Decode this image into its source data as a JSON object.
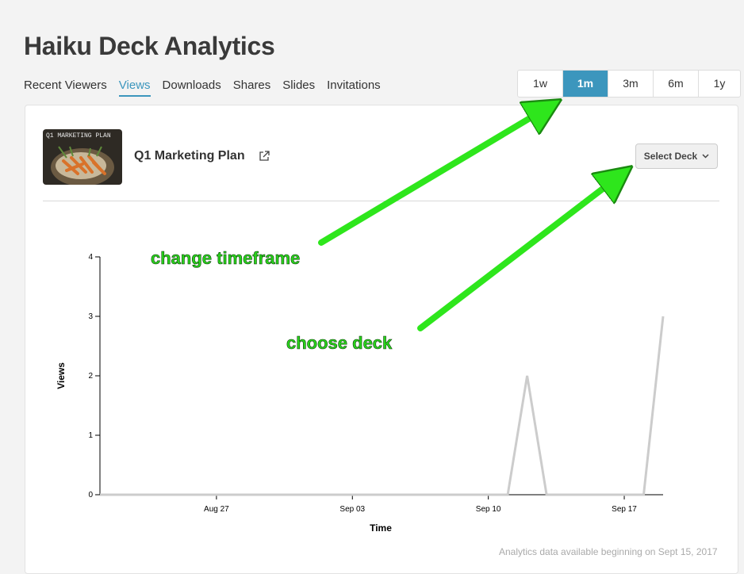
{
  "page": {
    "title": "Haiku Deck Analytics"
  },
  "nav": {
    "tabs": [
      {
        "label": "Recent Viewers",
        "active": false
      },
      {
        "label": "Views",
        "active": true
      },
      {
        "label": "Downloads",
        "active": false
      },
      {
        "label": "Shares",
        "active": false
      },
      {
        "label": "Slides",
        "active": false
      },
      {
        "label": "Invitations",
        "active": false
      }
    ]
  },
  "timeframe": {
    "options": [
      "1w",
      "1m",
      "3m",
      "6m",
      "1y"
    ],
    "selected": "1m"
  },
  "deck": {
    "title": "Q1 Marketing Plan",
    "thumbnail_caption": "Q1 MARKETING PLAN"
  },
  "select_deck": {
    "label": "Select Deck"
  },
  "annotations": {
    "timeframe_note": "change timeframe",
    "deck_note": "choose deck",
    "color": "#2ad41c"
  },
  "footnote": "Analytics data available beginning on Sept 15, 2017",
  "colors": {
    "accent": "#3c96bd",
    "line": "#cccccc"
  },
  "chart_data": {
    "type": "line",
    "xlabel": "Time",
    "ylabel": "Views",
    "ylim": [
      0,
      4
    ],
    "yticks": [
      0,
      1,
      2,
      3,
      4
    ],
    "xticks": [
      "Aug 27",
      "Sep 03",
      "Sep 10",
      "Sep 17"
    ],
    "x": [
      "Aug 21",
      "Sep 11",
      "Sep 12",
      "Sep 13",
      "Sep 18",
      "Sep 19"
    ],
    "series": [
      {
        "values": [
          0,
          0,
          2,
          0,
          0,
          3
        ]
      }
    ]
  }
}
